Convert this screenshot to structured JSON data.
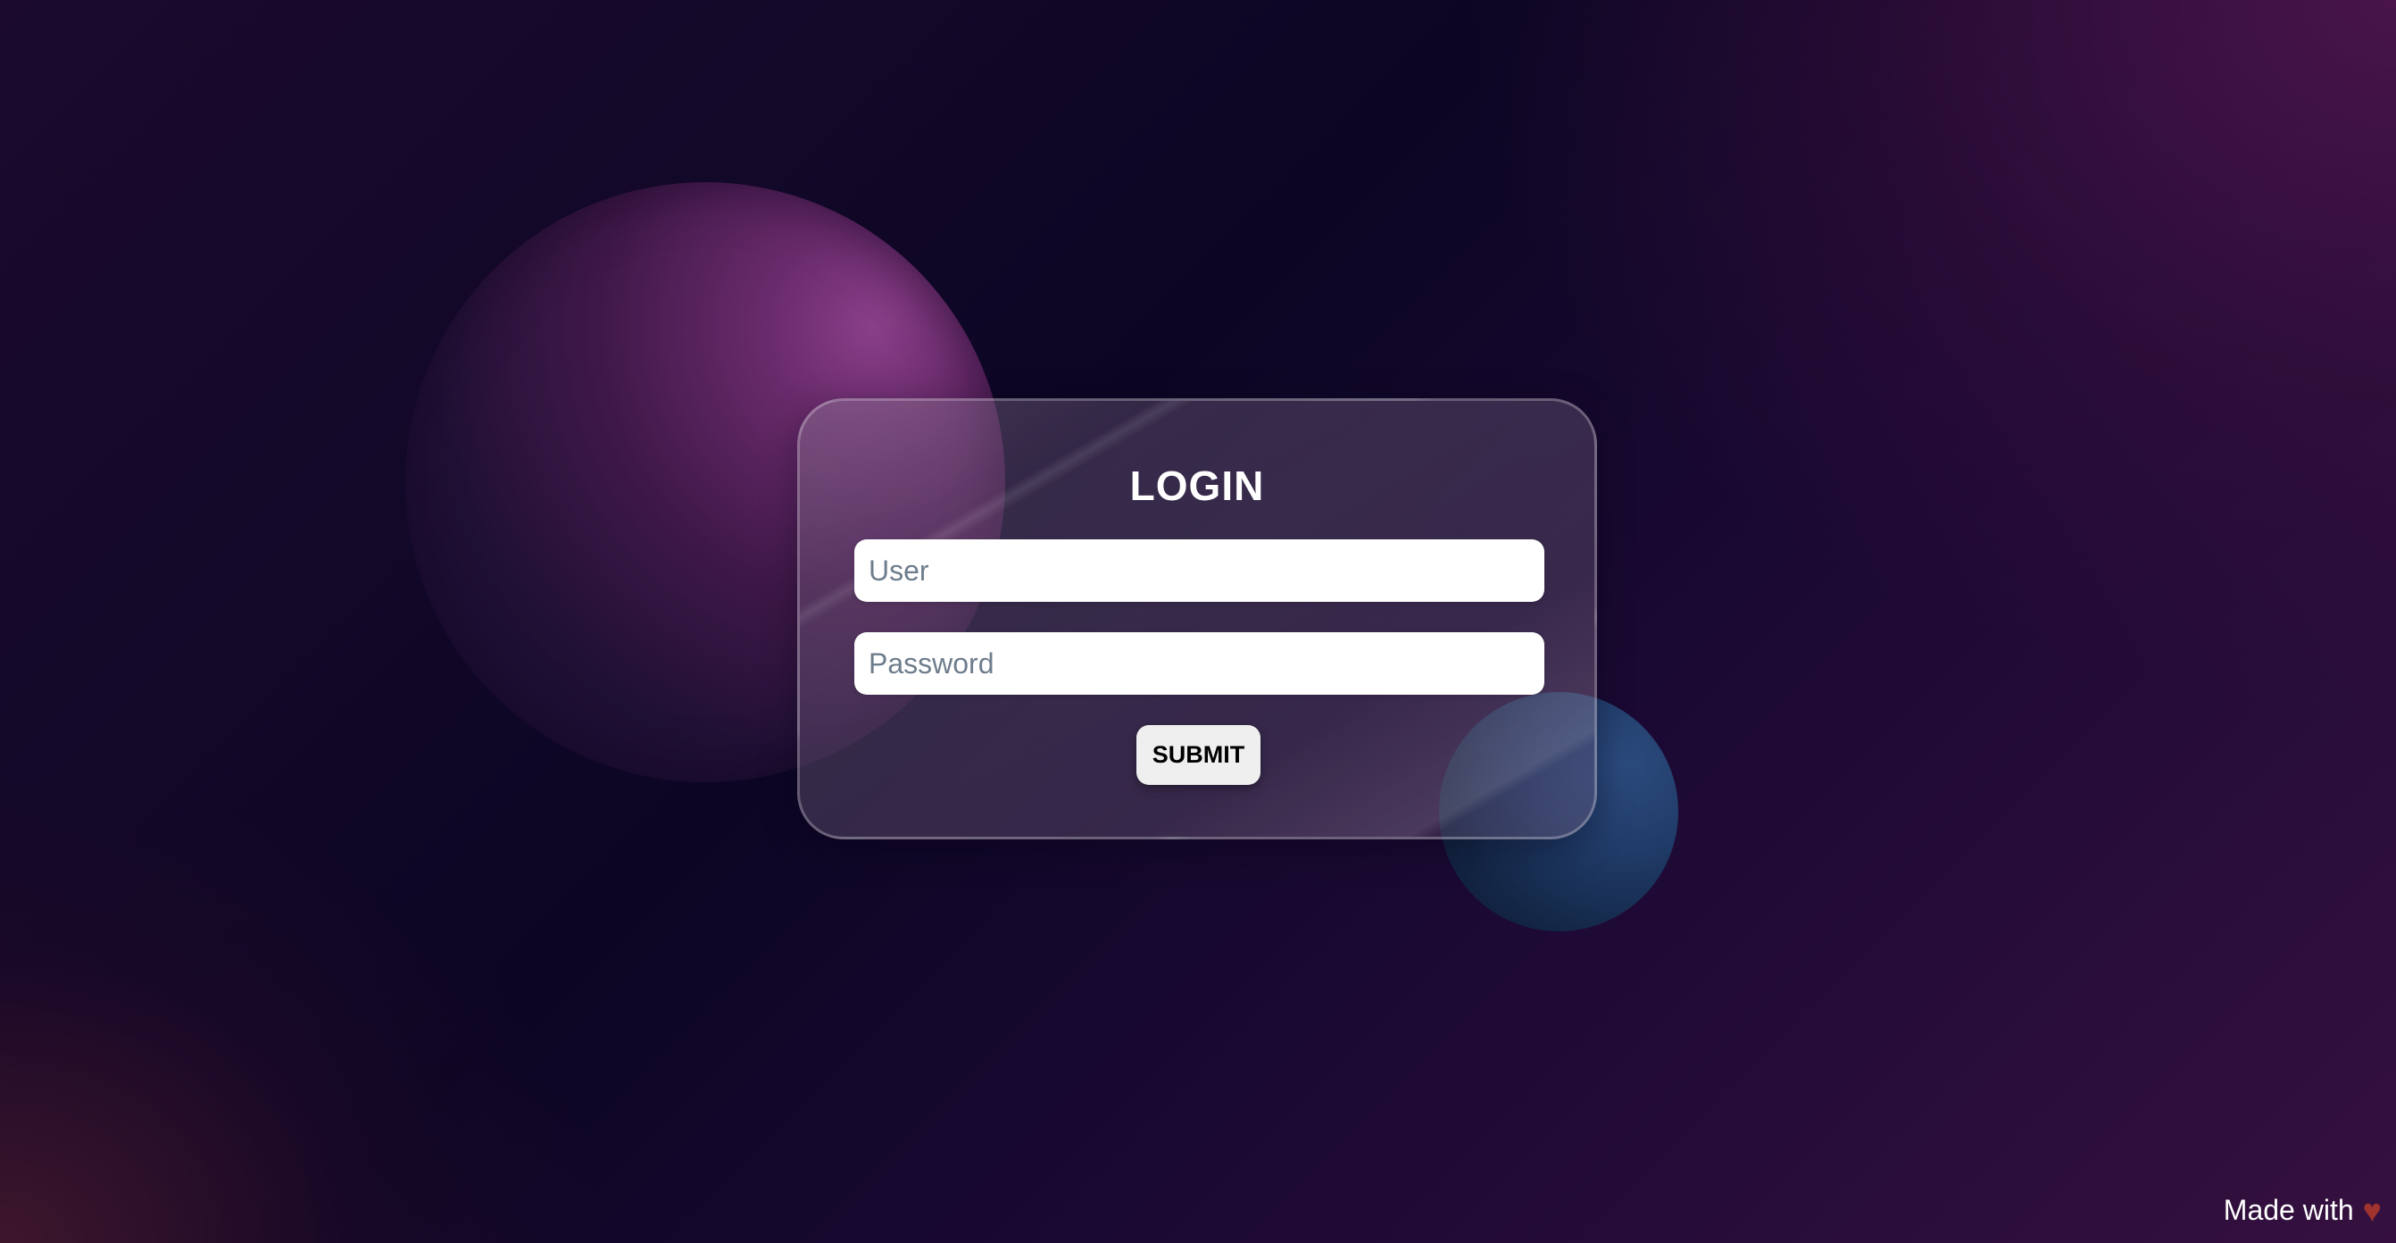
{
  "login": {
    "title": "LOGIN",
    "user_placeholder": "User",
    "password_placeholder": "Password",
    "submit_label": "SUBMIT"
  },
  "footer": {
    "text": "Made with",
    "icon": "heart-icon",
    "icon_glyph": "♥",
    "icon_color": "#a0332e"
  },
  "colors": {
    "background_dark": "#0c0624",
    "background_purple": "#35103f",
    "orb_pink": "#8a3f88",
    "orb_blue": "#2c4b7e"
  }
}
